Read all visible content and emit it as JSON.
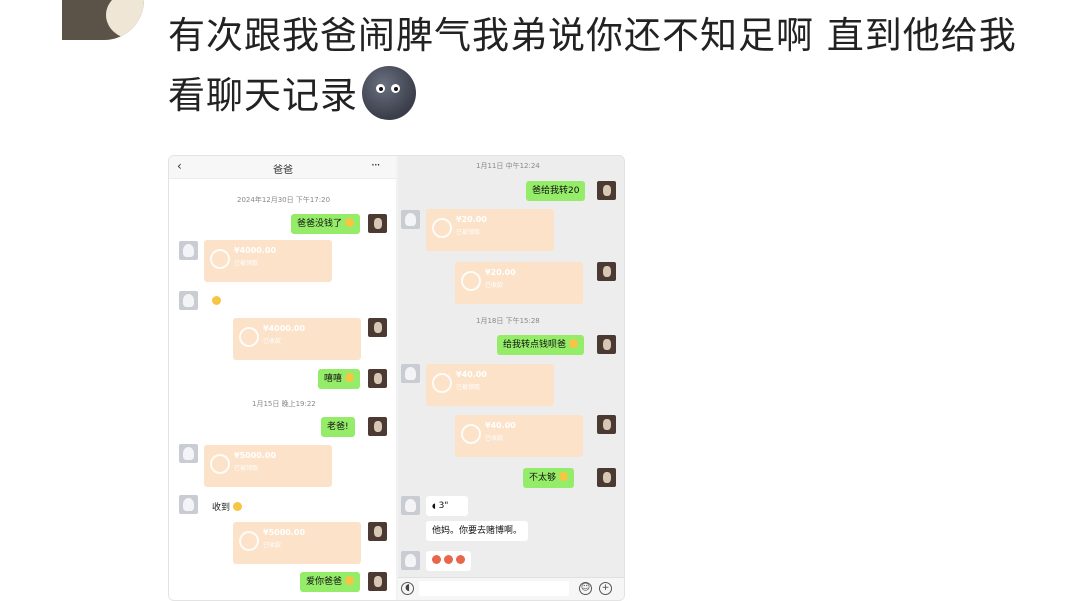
{
  "post": {
    "text": "有次跟我爸闹脾气我弟说你还不知足啊 直到他给我看聊天记录",
    "emoji_icon": "new-moon-face-icon"
  },
  "left": {
    "title": "爸爸",
    "back_icon": "chevron-left-icon",
    "more_icon": "more-dots-icon",
    "ts1": "2024年12月30日 下午17:20",
    "msg1": "爸爸没钱了",
    "tr1_amount": "¥4000.00",
    "tr1_status": "已被领取",
    "tr2_amount": "¥4000.00",
    "tr2_status": "已收款",
    "msg2": "嘻嘻",
    "ts2": "1月15日 晚上19:22",
    "msg3": "老爸!",
    "tr3_amount": "¥5000.00",
    "tr3_status": "已被领取",
    "msg4": "收到",
    "tr4_amount": "¥5000.00",
    "tr4_status": "已收款",
    "msg5": "爱你爸爸"
  },
  "right": {
    "ts1": "1月11日 中午12:24",
    "msg1": "爸给我转20",
    "tr1_amount": "¥20.00",
    "tr1_status": "已被领取",
    "tr2_amount": "¥20.00",
    "tr2_status": "已收款",
    "ts2": "1月18日 下午15:28",
    "msg2": "给我转点钱呗爸",
    "tr3_amount": "¥40.00",
    "tr3_status": "已被领取",
    "tr4_amount": "¥40.00",
    "tr4_status": "已收款",
    "msg3": "不太够",
    "voice": "3\"",
    "msg4": "他妈。你要去赌博啊。",
    "voice_icon": "voice-icon",
    "emoji_icon": "emoji-icon",
    "plus_icon": "plus-icon"
  }
}
